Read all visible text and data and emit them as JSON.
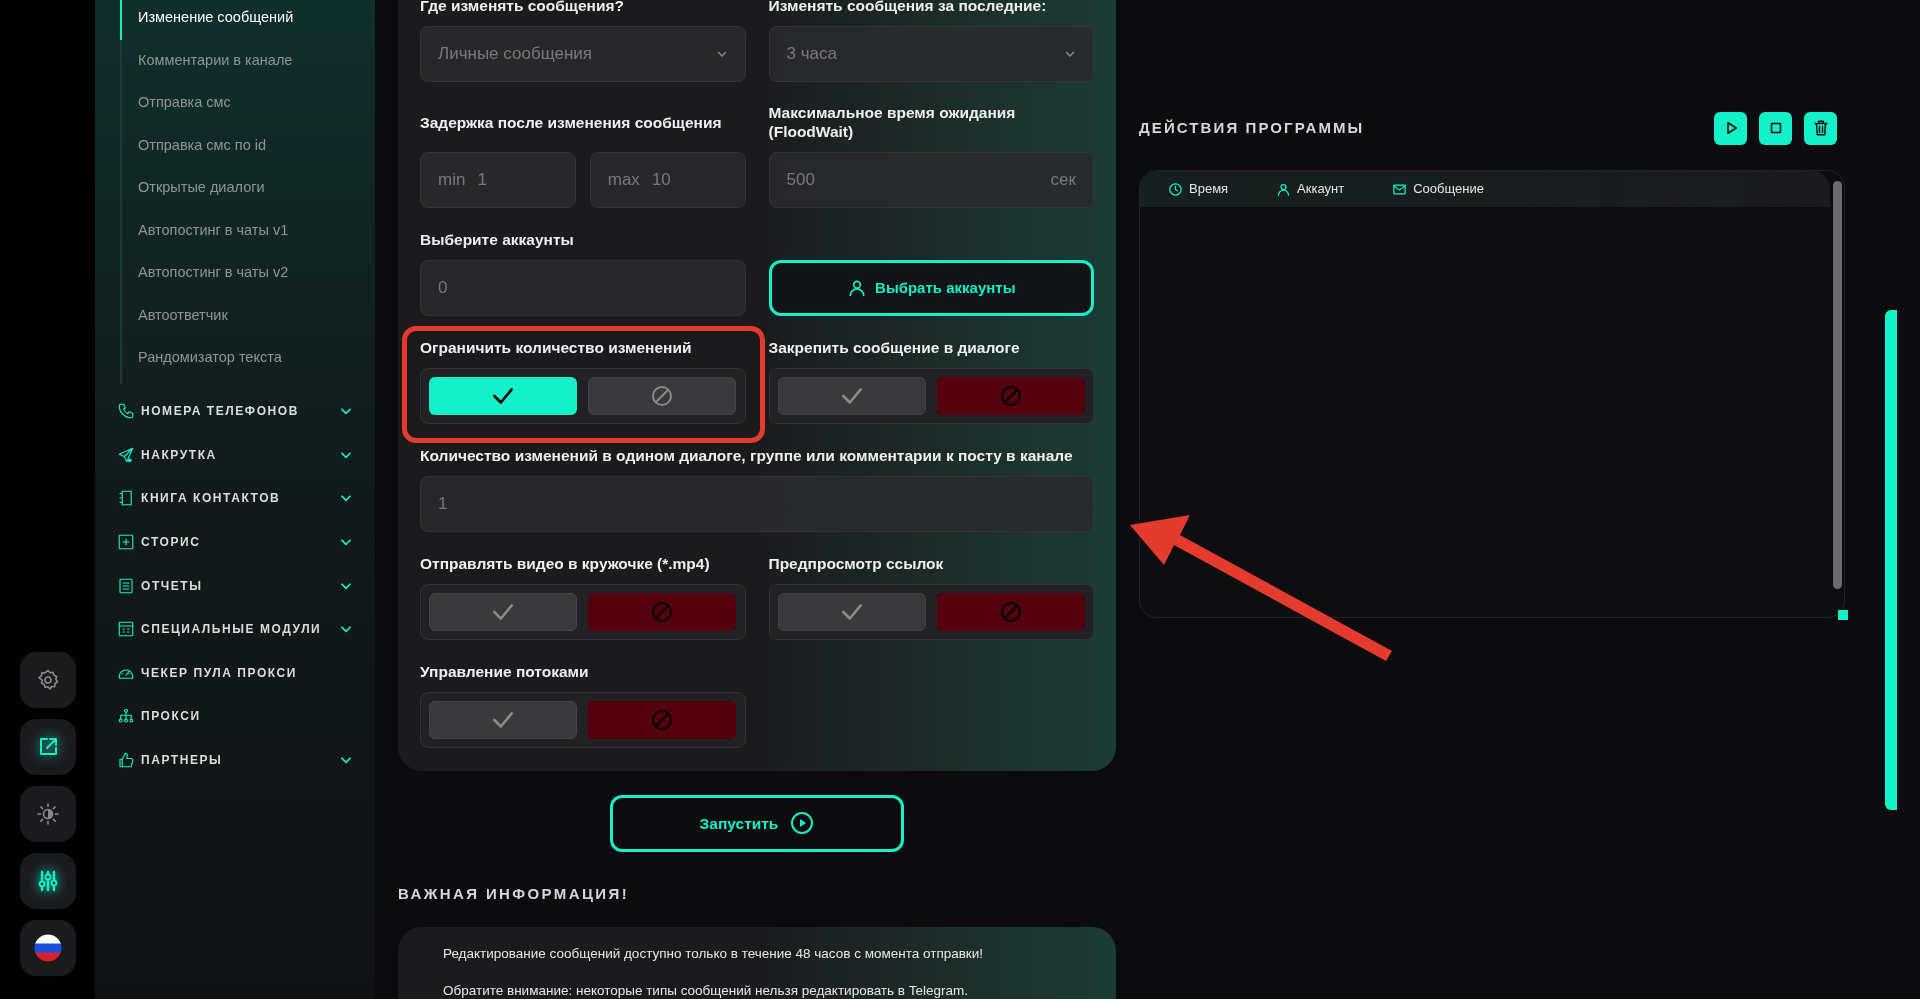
{
  "rail": [
    {
      "kind": "gear",
      "active": false
    },
    {
      "kind": "share",
      "active": true
    },
    {
      "kind": "theme",
      "active": false
    },
    {
      "kind": "sliders",
      "active": true
    },
    {
      "kind": "flag"
    }
  ],
  "sidebar": {
    "subitems": [
      {
        "label": "Изменение сообщений",
        "selected": true
      },
      {
        "label": "Комментарии в канале",
        "selected": false
      },
      {
        "label": "Отправка смс",
        "selected": false
      },
      {
        "label": "Отправка смс по id",
        "selected": false
      },
      {
        "label": "Открытые диалоги",
        "selected": false
      },
      {
        "label": "Автопостинг в чаты v1",
        "selected": false
      },
      {
        "label": "Автопостинг в чаты v2",
        "selected": false
      },
      {
        "label": "Автоответчик",
        "selected": false
      },
      {
        "label": "Рандомизатор текста",
        "selected": false
      }
    ],
    "sections": [
      {
        "kind": "phone",
        "label": "НОМЕРА ТЕЛЕФОНОВ",
        "expandable": true
      },
      {
        "kind": "send",
        "label": "НАКРУТКА",
        "expandable": true
      },
      {
        "kind": "book",
        "label": "КНИГА КОНТАКТОВ",
        "expandable": true
      },
      {
        "kind": "plus",
        "label": "СТОРИС",
        "expandable": true
      },
      {
        "kind": "report",
        "label": "ОТЧЕТЫ",
        "expandable": true
      },
      {
        "kind": "calc",
        "label": "СПЕЦИАЛЬНЫЕ МОДУЛИ",
        "expandable": true
      },
      {
        "kind": "gauge",
        "label": "ЧЕКЕР ПУЛА ПРОКСИ",
        "expandable": false
      },
      {
        "kind": "network",
        "label": "ПРОКСИ",
        "expandable": false
      },
      {
        "kind": "thumb",
        "label": "ПАРТНЕРЫ",
        "expandable": true
      }
    ]
  },
  "form": {
    "cells": [
      {
        "kind": "select",
        "label": "Где изменять сообщения?",
        "value": "Личные сообщения"
      },
      {
        "kind": "select",
        "label": "Изменять сообщения за последние:",
        "value": "3 часа"
      },
      {
        "kind": "range",
        "label": "Задержка после изменения сообщения",
        "min_prefix": "min",
        "min": "1",
        "max_prefix": "max",
        "max": "10"
      },
      {
        "kind": "unit",
        "label": "Максимальное время ожидания (FloodWait)",
        "value": "500",
        "unit": "сек"
      },
      {
        "kind": "input",
        "label": "Выберите аккаунты",
        "value": "0"
      },
      {
        "kind": "button",
        "button": "Выбрать аккаунты"
      },
      {
        "kind": "toggle",
        "label": "Ограничить количество изменений",
        "checked": true
      },
      {
        "kind": "toggle",
        "label": "Закрепить сообщение в диалоге",
        "checked": false
      },
      {
        "kind": "wide",
        "label": "Количество изменений в одином диалоге, группе или комментарии к посту в канале",
        "value": "1"
      },
      {
        "kind": "toggle",
        "label": "Отправлять видео в кружочке (*.mp4)",
        "checked": false
      },
      {
        "kind": "toggle",
        "label": "Предпросмотр ссылок",
        "checked": false
      },
      {
        "kind": "toggle",
        "label": "Управление потоками",
        "checked": false
      }
    ],
    "launch": "Запустить"
  },
  "info": {
    "title": "ВАЖНАЯ ИНФОРМАЦИЯ!",
    "lines": [
      "Редактирование сообщений доступно только в течение 48 часов с момента отправки!",
      "Обратите внимание: некоторые типы сообщений нельзя редактировать в Telegram."
    ]
  },
  "log": {
    "title": "ДЕЙСТВИЯ ПРОГРАММЫ",
    "columns": [
      {
        "kind": "clock",
        "label": "Время"
      },
      {
        "kind": "user",
        "label": "Аккаунт"
      },
      {
        "kind": "mail",
        "label": "Сообщение"
      }
    ]
  }
}
